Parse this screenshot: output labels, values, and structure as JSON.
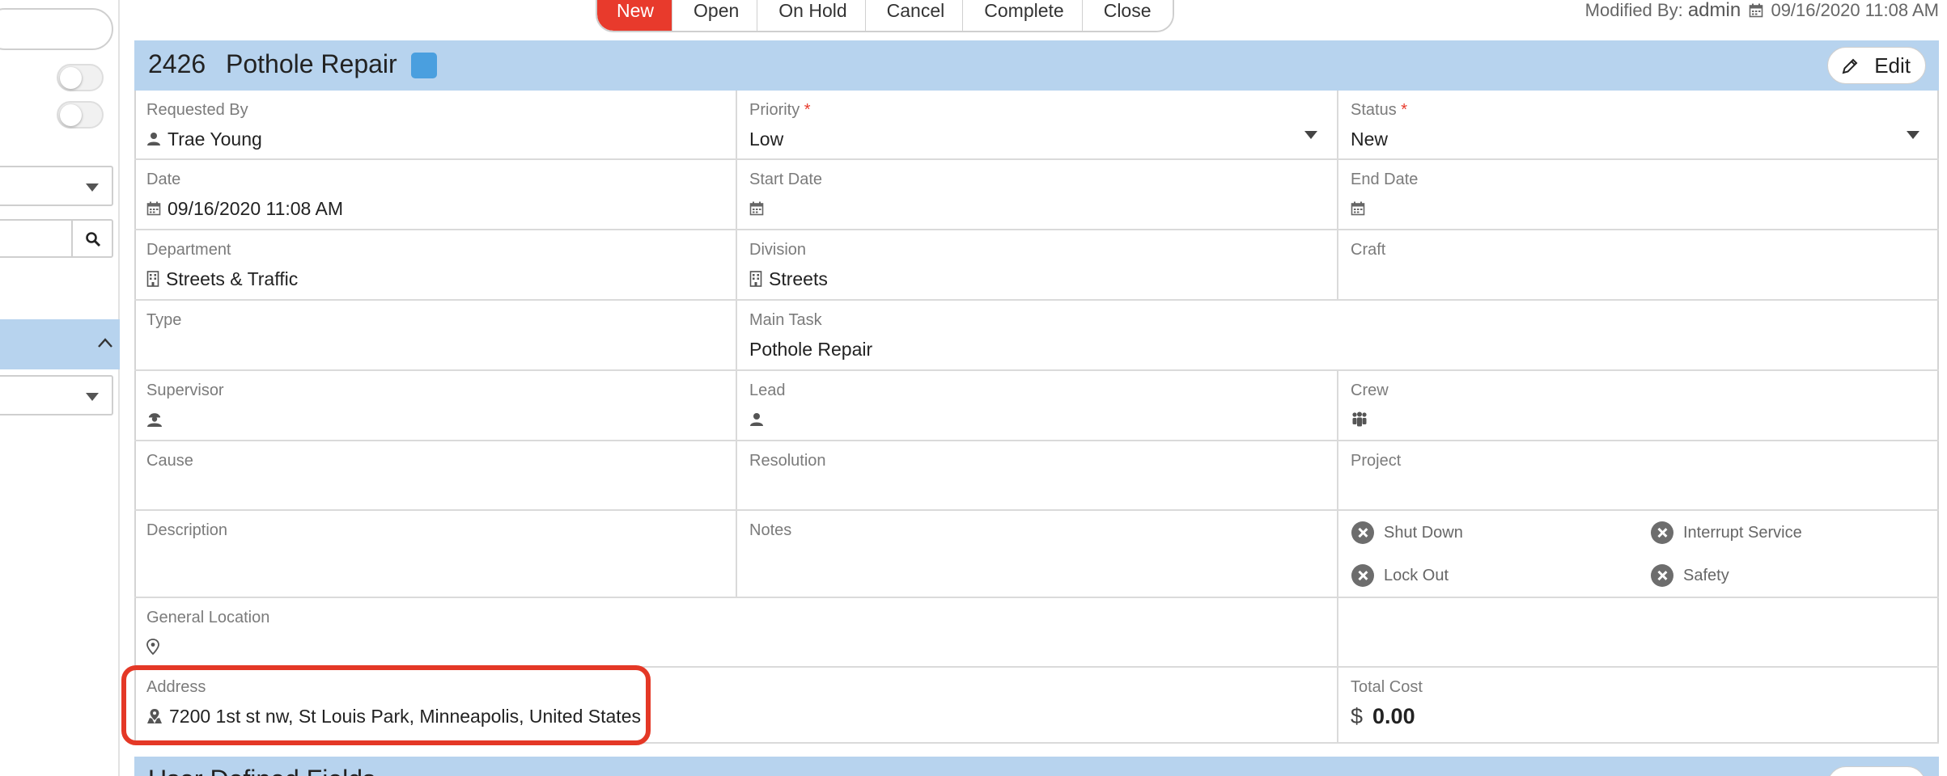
{
  "sidebar": {
    "search_placeholder": "",
    "section_collapse_icon": "chevron-up-icon"
  },
  "pipeline": {
    "stages": [
      "New",
      "Open",
      "On Hold",
      "Cancel",
      "Complete",
      "Close"
    ],
    "active": "New"
  },
  "modified": {
    "label": "Modified By:",
    "user": "admin",
    "datetime": "09/16/2020 11:08 AM"
  },
  "header": {
    "number": "2426",
    "title": "Pothole Repair",
    "chip_color": "#4a9fdf",
    "edit_label": "Edit"
  },
  "fields": {
    "requested_by": {
      "label": "Requested By",
      "value": "Trae Young"
    },
    "priority": {
      "label": "Priority",
      "required": "*",
      "value": "Low"
    },
    "status": {
      "label": "Status",
      "required": "*",
      "value": "New"
    },
    "date": {
      "label": "Date",
      "value": "09/16/2020 11:08 AM"
    },
    "start_date": {
      "label": "Start Date",
      "value": ""
    },
    "end_date": {
      "label": "End Date",
      "value": ""
    },
    "department": {
      "label": "Department",
      "value": "Streets & Traffic"
    },
    "division": {
      "label": "Division",
      "value": "Streets"
    },
    "craft": {
      "label": "Craft",
      "value": ""
    },
    "type": {
      "label": "Type",
      "value": ""
    },
    "main_task": {
      "label": "Main Task",
      "value": "Pothole Repair"
    },
    "supervisor": {
      "label": "Supervisor",
      "value": ""
    },
    "lead": {
      "label": "Lead",
      "value": ""
    },
    "crew": {
      "label": "Crew",
      "value": ""
    },
    "cause": {
      "label": "Cause",
      "value": ""
    },
    "resolution": {
      "label": "Resolution",
      "value": ""
    },
    "project": {
      "label": "Project",
      "value": ""
    },
    "description": {
      "label": "Description",
      "value": ""
    },
    "notes": {
      "label": "Notes",
      "value": ""
    },
    "general_location": {
      "label": "General Location",
      "value": ""
    },
    "address": {
      "label": "Address",
      "value": "7200 1st st nw, St Louis Park, Minneapolis, United States"
    },
    "total_cost": {
      "label": "Total Cost",
      "currency": "$",
      "value": "0.00"
    }
  },
  "flags": [
    {
      "label": "Shut Down",
      "checked": false
    },
    {
      "label": "Interrupt Service",
      "checked": false
    },
    {
      "label": "Lock Out",
      "checked": false
    },
    {
      "label": "Safety",
      "checked": false
    }
  ],
  "udf": {
    "title": "User Defined Fields"
  },
  "colors": {
    "accent": "#e83a2c",
    "header_bg": "#b7d3ee",
    "highlight": "#e43826"
  }
}
